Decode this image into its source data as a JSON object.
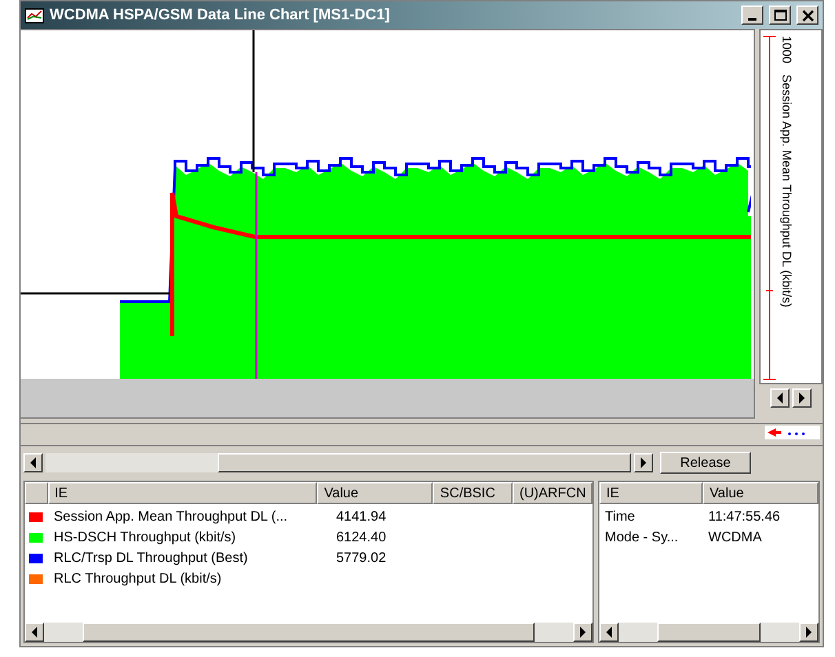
{
  "window": {
    "title": "WCDMA HSPA/GSM Data Line Chart [MS1-DC1]"
  },
  "axis": {
    "top_value": "1000",
    "label": "Session App. Mean Throughput DL (kbit/s)"
  },
  "scroll_button": "Release",
  "ie_list": {
    "columns": [
      "IE",
      "Value",
      "SC/BSIC",
      "(U)ARFCN"
    ],
    "rows": [
      {
        "name": "Session App. Mean Throughput DL (...",
        "color": "#ff0000",
        "value": "4141.94"
      },
      {
        "name": "HS-DSCH Throughput (kbit/s)",
        "color": "#00ff00",
        "value": "6124.40"
      },
      {
        "name": "RLC/Trsp DL Throughput (Best)",
        "color": "#0000ff",
        "value": "5779.02"
      },
      {
        "name": "RLC Throughput DL (kbit/s)",
        "color": "#ff6600"
      }
    ]
  },
  "info_list": {
    "columns": [
      "IE",
      "Value"
    ],
    "rows": [
      {
        "name": "Time",
        "value": "11:47:55.46"
      },
      {
        "name": "Mode - Sy...",
        "value": "WCDMA"
      }
    ]
  }
}
